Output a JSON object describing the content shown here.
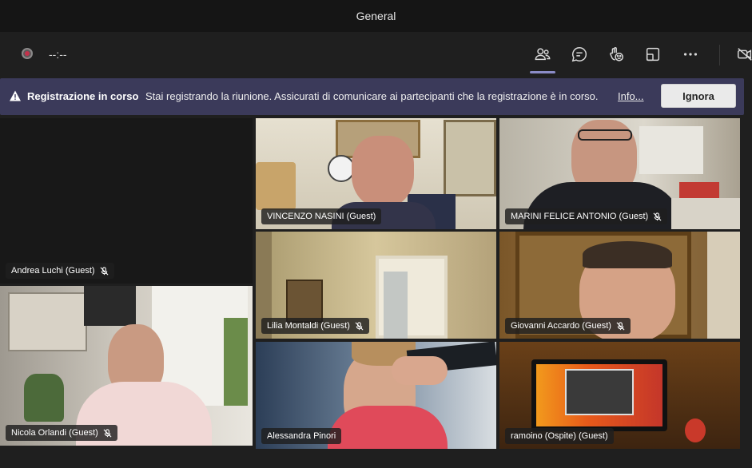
{
  "window": {
    "title": "General"
  },
  "toolbar": {
    "timer": "--:--",
    "icons": [
      "people-icon",
      "chat-icon",
      "reactions-icon",
      "share-icon",
      "more-icon",
      "camera-off-icon"
    ]
  },
  "banner": {
    "title": "Registrazione in corso",
    "message": "Stai registrando la riunione. Assicurati di comunicare ai partecipanti che la registrazione è in corso.",
    "link": "Info...",
    "ignore_label": "Ignora"
  },
  "participants": [
    {
      "name": "Andrea Luchi (Guest)",
      "muted": true
    },
    {
      "name": "VINCENZO NASINI (Guest)",
      "muted": false
    },
    {
      "name": "MARINI FELICE ANTONIO (Guest)",
      "muted": true
    },
    {
      "name": "Lilia Montaldi (Guest)",
      "muted": true
    },
    {
      "name": "Giovanni Accardo (Guest)",
      "muted": true
    },
    {
      "name": "Nicola Orlandi (Guest)",
      "muted": true
    },
    {
      "name": "Alessandra Pinori",
      "muted": false
    },
    {
      "name": "ramoino (Ospite) (Guest)",
      "muted": false
    }
  ],
  "colors": {
    "banner": "#3b3a5a",
    "record": "#c4314b",
    "accent": "#8b8cc7"
  }
}
